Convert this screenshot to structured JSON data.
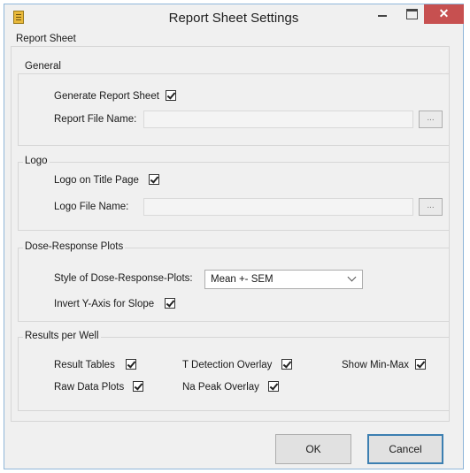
{
  "window": {
    "title": "Report Sheet Settings",
    "close_glyph": "✕",
    "icon": "report-app-icon"
  },
  "report_sheet": {
    "label": "Report Sheet"
  },
  "general": {
    "label": "General",
    "generate_label": "Generate Report Sheet",
    "generate_checked": true,
    "file_name_label": "Report File Name:",
    "file_name_value": "",
    "browse_label": "..."
  },
  "logo": {
    "label": "Logo",
    "on_title_label": "Logo on Title Page",
    "on_title_checked": true,
    "file_name_label": "Logo File Name:",
    "file_name_value": "",
    "browse_label": "..."
  },
  "dose_response": {
    "label": "Dose-Response Plots",
    "style_label": "Style of Dose-Response-Plots:",
    "style_value": "Mean +- SEM",
    "invert_label": "Invert Y-Axis for Slope",
    "invert_checked": true
  },
  "results": {
    "label": "Results per Well",
    "result_tables": "Result Tables",
    "t_detection": "T Detection Overlay",
    "show_min_max": "Show Min-Max",
    "raw_data_plots": "Raw Data Plots",
    "na_peak": "Na Peak Overlay"
  },
  "buttons": {
    "ok": "OK",
    "cancel": "Cancel"
  }
}
